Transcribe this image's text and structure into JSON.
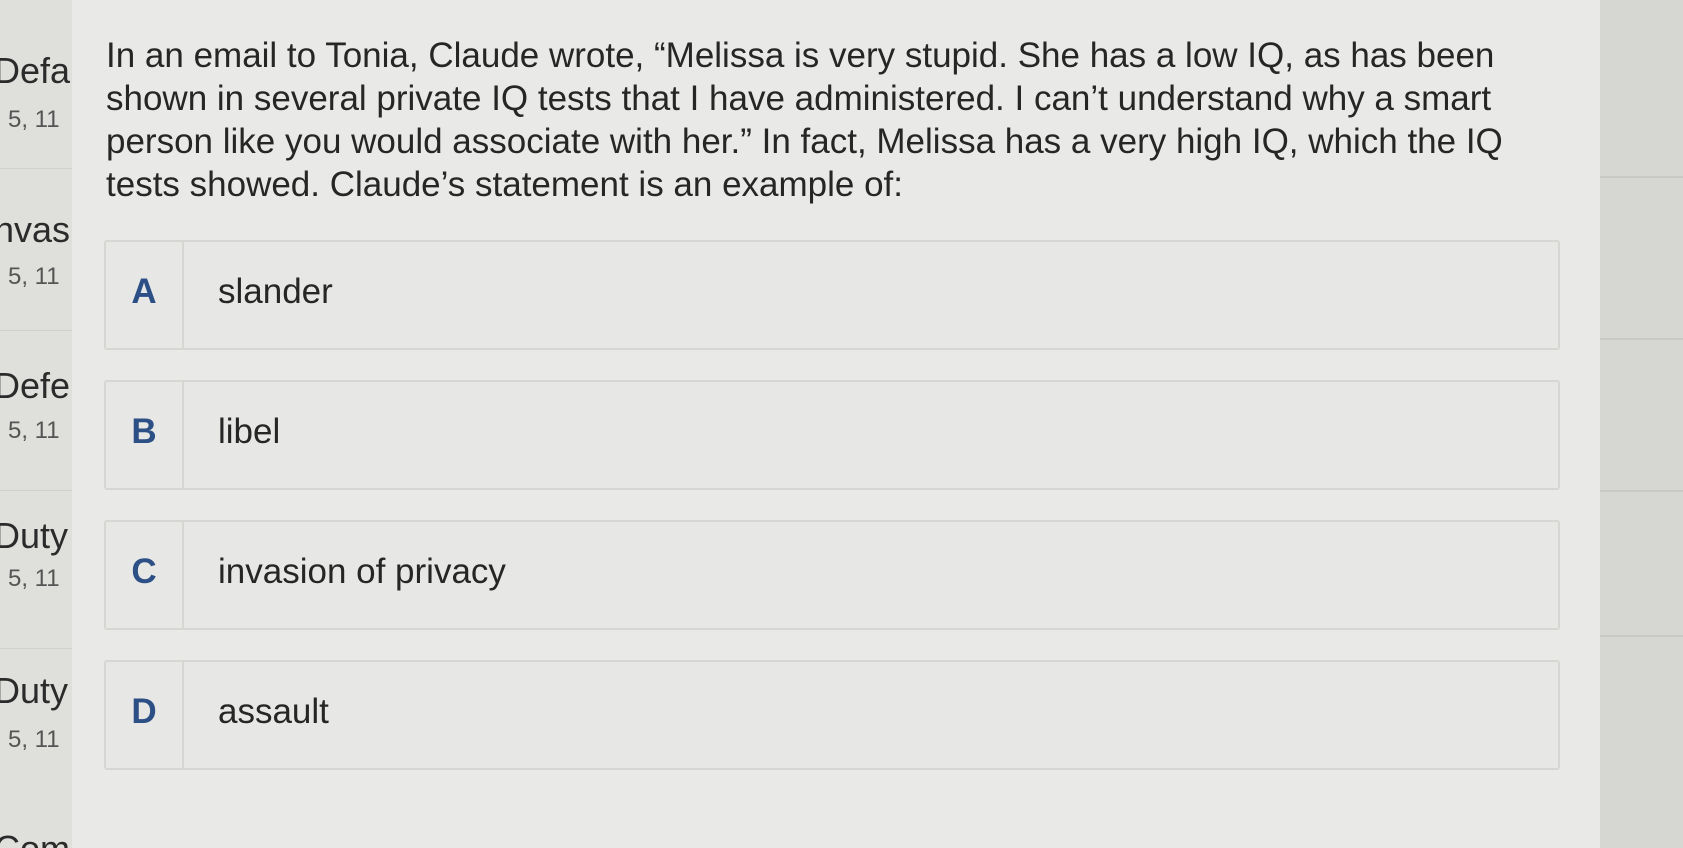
{
  "sidebar": {
    "items": [
      {
        "title": "Defa",
        "sub": "5, 11"
      },
      {
        "title": "nvas",
        "sub": "5, 11"
      },
      {
        "title": "Defe",
        "sub": "5, 11"
      },
      {
        "title": "Duty",
        "sub": "5, 11"
      },
      {
        "title": "Duty",
        "sub": "5, 11"
      },
      {
        "title": "Com",
        "sub": ""
      }
    ]
  },
  "question": {
    "text": "In an email to Tonia, Claude wrote, “Melissa is very stupid. She has a low IQ, as has been shown in several private IQ tests that I have administered. I can’t understand why a smart person like you would associate with her.” In fact, Melissa has a very high IQ, which the IQ tests showed. Claude’s statement is an example of:"
  },
  "options": [
    {
      "letter": "A",
      "text": "slander"
    },
    {
      "letter": "B",
      "text": "libel"
    },
    {
      "letter": "C",
      "text": "invasion of privacy"
    },
    {
      "letter": "D",
      "text": "assault"
    }
  ],
  "colors": {
    "letter": "#2c4f86",
    "text": "#262626",
    "background": "#e9e9e7"
  }
}
